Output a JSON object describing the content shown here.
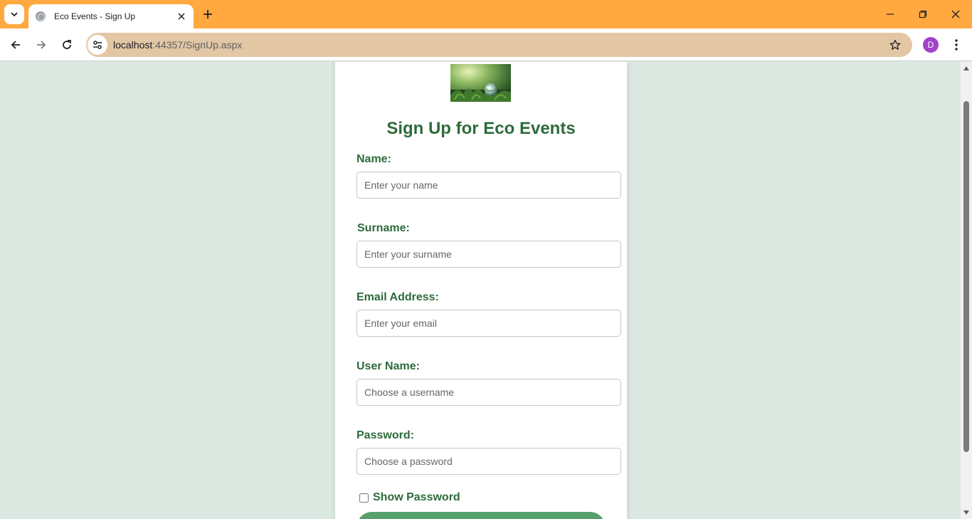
{
  "browser": {
    "tab_title": "Eco Events - Sign Up",
    "url_host": "localhost",
    "url_rest": ":44357/SignUp.aspx",
    "profile_initial": "D"
  },
  "colors": {
    "tabbar": "#ffa940",
    "page_background": "#dce9e2",
    "heading": "#2e6b3c",
    "button": "#55a06d"
  },
  "form": {
    "heading": "Sign Up for Eco Events",
    "fields": [
      {
        "label": "Name:",
        "placeholder": "Enter your name"
      },
      {
        "label": "Surname:",
        "placeholder": "Enter your surname"
      },
      {
        "label": "Email Address:",
        "placeholder": "Enter your email"
      },
      {
        "label": "User Name:",
        "placeholder": "Choose a username"
      },
      {
        "label": "Password:",
        "placeholder": "Choose a password"
      }
    ],
    "show_password_label": "Show Password",
    "show_password_checked": false
  }
}
